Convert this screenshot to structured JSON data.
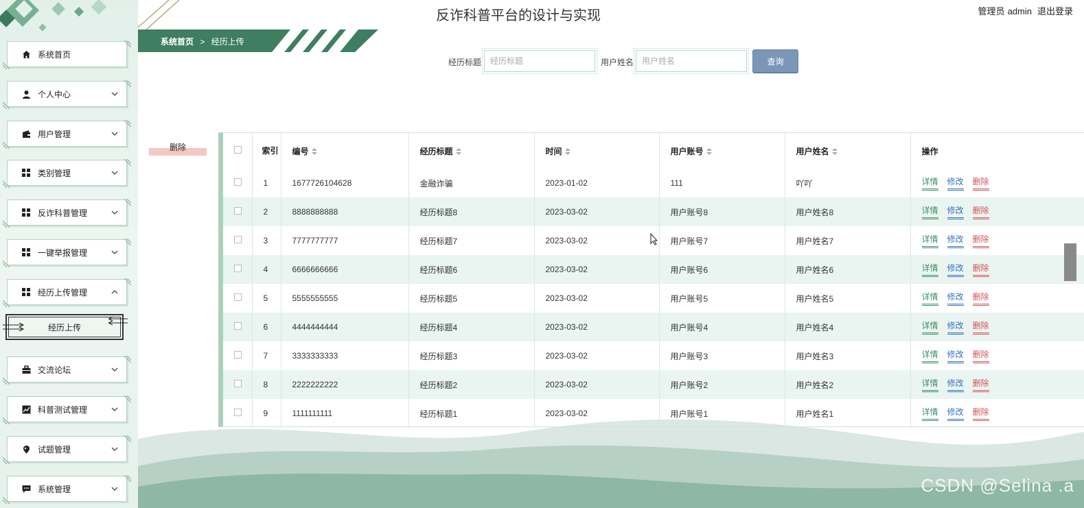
{
  "app_title": "反诈科普平台的设计与实现",
  "user": {
    "role": "管理员",
    "name": "admin",
    "logout": "退出登录"
  },
  "breadcrumb": {
    "home": "系统首页",
    "sep": ">",
    "current": "经历上传"
  },
  "sidebar": {
    "items": [
      {
        "label": "系统首页",
        "icon": "home-icon"
      },
      {
        "label": "个人中心",
        "icon": "person-icon"
      },
      {
        "label": "用户管理",
        "icon": "wallet-icon"
      },
      {
        "label": "类别管理",
        "icon": "grid-icon"
      },
      {
        "label": "反诈科普管理",
        "icon": "grid-icon"
      },
      {
        "label": "一键举报管理",
        "icon": "grid-icon"
      },
      {
        "label": "经历上传管理",
        "icon": "grid-icon"
      },
      {
        "label": "交流论坛",
        "icon": "briefcase-icon"
      },
      {
        "label": "科普测试管理",
        "icon": "chart-icon"
      },
      {
        "label": "试题管理",
        "icon": "pin-icon"
      },
      {
        "label": "系统管理",
        "icon": "chat-icon"
      }
    ],
    "sub_item": "经历上传"
  },
  "search": {
    "title_label": "经历标题",
    "title_placeholder": "经历标题",
    "name_label": "用户姓名",
    "name_placeholder": "用户姓名",
    "button": "查询"
  },
  "delete_button": "删除",
  "table": {
    "headers": [
      "索引",
      "编号",
      "经历标题",
      "时间",
      "用户账号",
      "用户姓名",
      "操作"
    ],
    "rows": [
      {
        "idx": "1",
        "id": "1677726104628",
        "title": "金融诈骗",
        "time": "2023-01-02",
        "account": "111",
        "name": "吖吖"
      },
      {
        "idx": "2",
        "id": "8888888888",
        "title": "经历标题8",
        "time": "2023-03-02",
        "account": "用户账号8",
        "name": "用户姓名8"
      },
      {
        "idx": "3",
        "id": "7777777777",
        "title": "经历标题7",
        "time": "2023-03-02",
        "account": "用户账号7",
        "name": "用户姓名7"
      },
      {
        "idx": "4",
        "id": "6666666666",
        "title": "经历标题6",
        "time": "2023-03-02",
        "account": "用户账号6",
        "name": "用户姓名6"
      },
      {
        "idx": "5",
        "id": "5555555555",
        "title": "经历标题5",
        "time": "2023-03-02",
        "account": "用户账号5",
        "name": "用户姓名5"
      },
      {
        "idx": "6",
        "id": "4444444444",
        "title": "经历标题4",
        "time": "2023-03-02",
        "account": "用户账号4",
        "name": "用户姓名4"
      },
      {
        "idx": "7",
        "id": "3333333333",
        "title": "经历标题3",
        "time": "2023-03-02",
        "account": "用户账号3",
        "name": "用户姓名3"
      },
      {
        "idx": "8",
        "id": "2222222222",
        "title": "经历标题2",
        "time": "2023-03-02",
        "account": "用户账号2",
        "name": "用户姓名2"
      },
      {
        "idx": "9",
        "id": "1111111111",
        "title": "经历标题1",
        "time": "2023-03-02",
        "account": "用户账号1",
        "name": "用户姓名1"
      }
    ],
    "actions": {
      "detail": "详情",
      "edit": "修改",
      "delete": "删除"
    }
  },
  "watermark": "CSDN @Selina .a",
  "colors": {
    "accent": "#3c7a5e",
    "detail": "#3c8f65",
    "edit": "#3372c4",
    "delete": "#d2535b",
    "search_button": "#7a97b8"
  }
}
